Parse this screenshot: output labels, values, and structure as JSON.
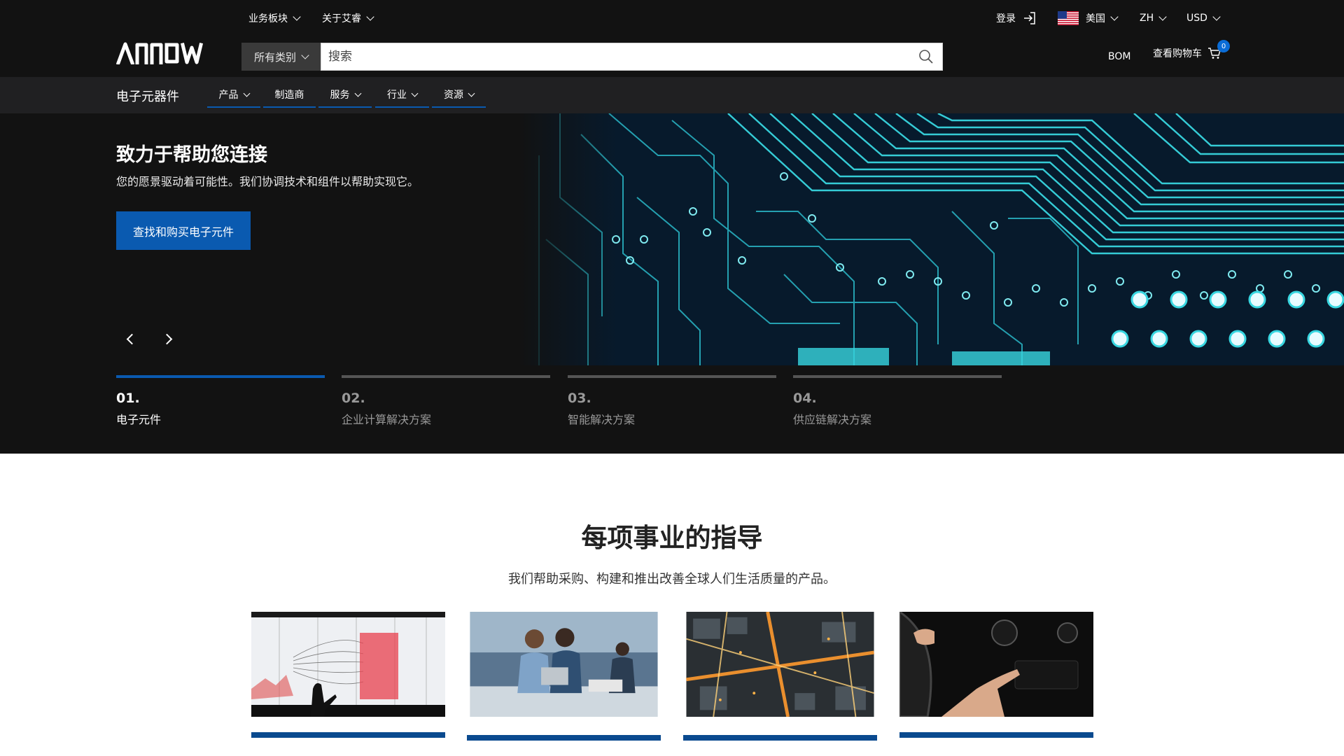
{
  "topbar": {
    "business_label": "业务板块",
    "about_label": "关于艾睿",
    "login_label": "登录",
    "country_label": "美国",
    "language_label": "ZH",
    "currency_label": "USD"
  },
  "header": {
    "search_category": "所有类别",
    "search_placeholder": "搜索",
    "bom_label": "BOM",
    "cart_label": "查看购物车",
    "cart_count": "0"
  },
  "nav": {
    "title": "电子元器件",
    "items": [
      {
        "label": "产品",
        "dropdown": true
      },
      {
        "label": "制造商",
        "dropdown": false
      },
      {
        "label": "服务",
        "dropdown": true
      },
      {
        "label": "行业",
        "dropdown": true
      },
      {
        "label": "资源",
        "dropdown": true
      }
    ]
  },
  "hero": {
    "title": "致力于帮助您连接",
    "subtitle": "您的愿景驱动着可能性。我们协调技术和组件以帮助实现它。",
    "cta_label": "查找和购买电子元件",
    "slides": [
      {
        "num": "01.",
        "label": "电子元件",
        "active": true
      },
      {
        "num": "02.",
        "label": "企业计算解决方案",
        "active": false
      },
      {
        "num": "03.",
        "label": "智能解决方案",
        "active": false
      },
      {
        "num": "04.",
        "label": "供应链解决方案",
        "active": false
      }
    ]
  },
  "section": {
    "title": "每项事业的指导",
    "subtitle": "我们帮助采购、构建和推出改善全球人们生活质量的产品。"
  },
  "colors": {
    "dark_bg": "#121212",
    "nav_bg": "#202022",
    "accent_blue": "#0a5ab0",
    "circuit_cyan": "#38d6e0"
  },
  "icons": [
    "chevron-down-icon",
    "login-icon",
    "us-flag-icon",
    "search-icon",
    "cart-icon",
    "chevron-left-icon",
    "chevron-right-icon"
  ]
}
